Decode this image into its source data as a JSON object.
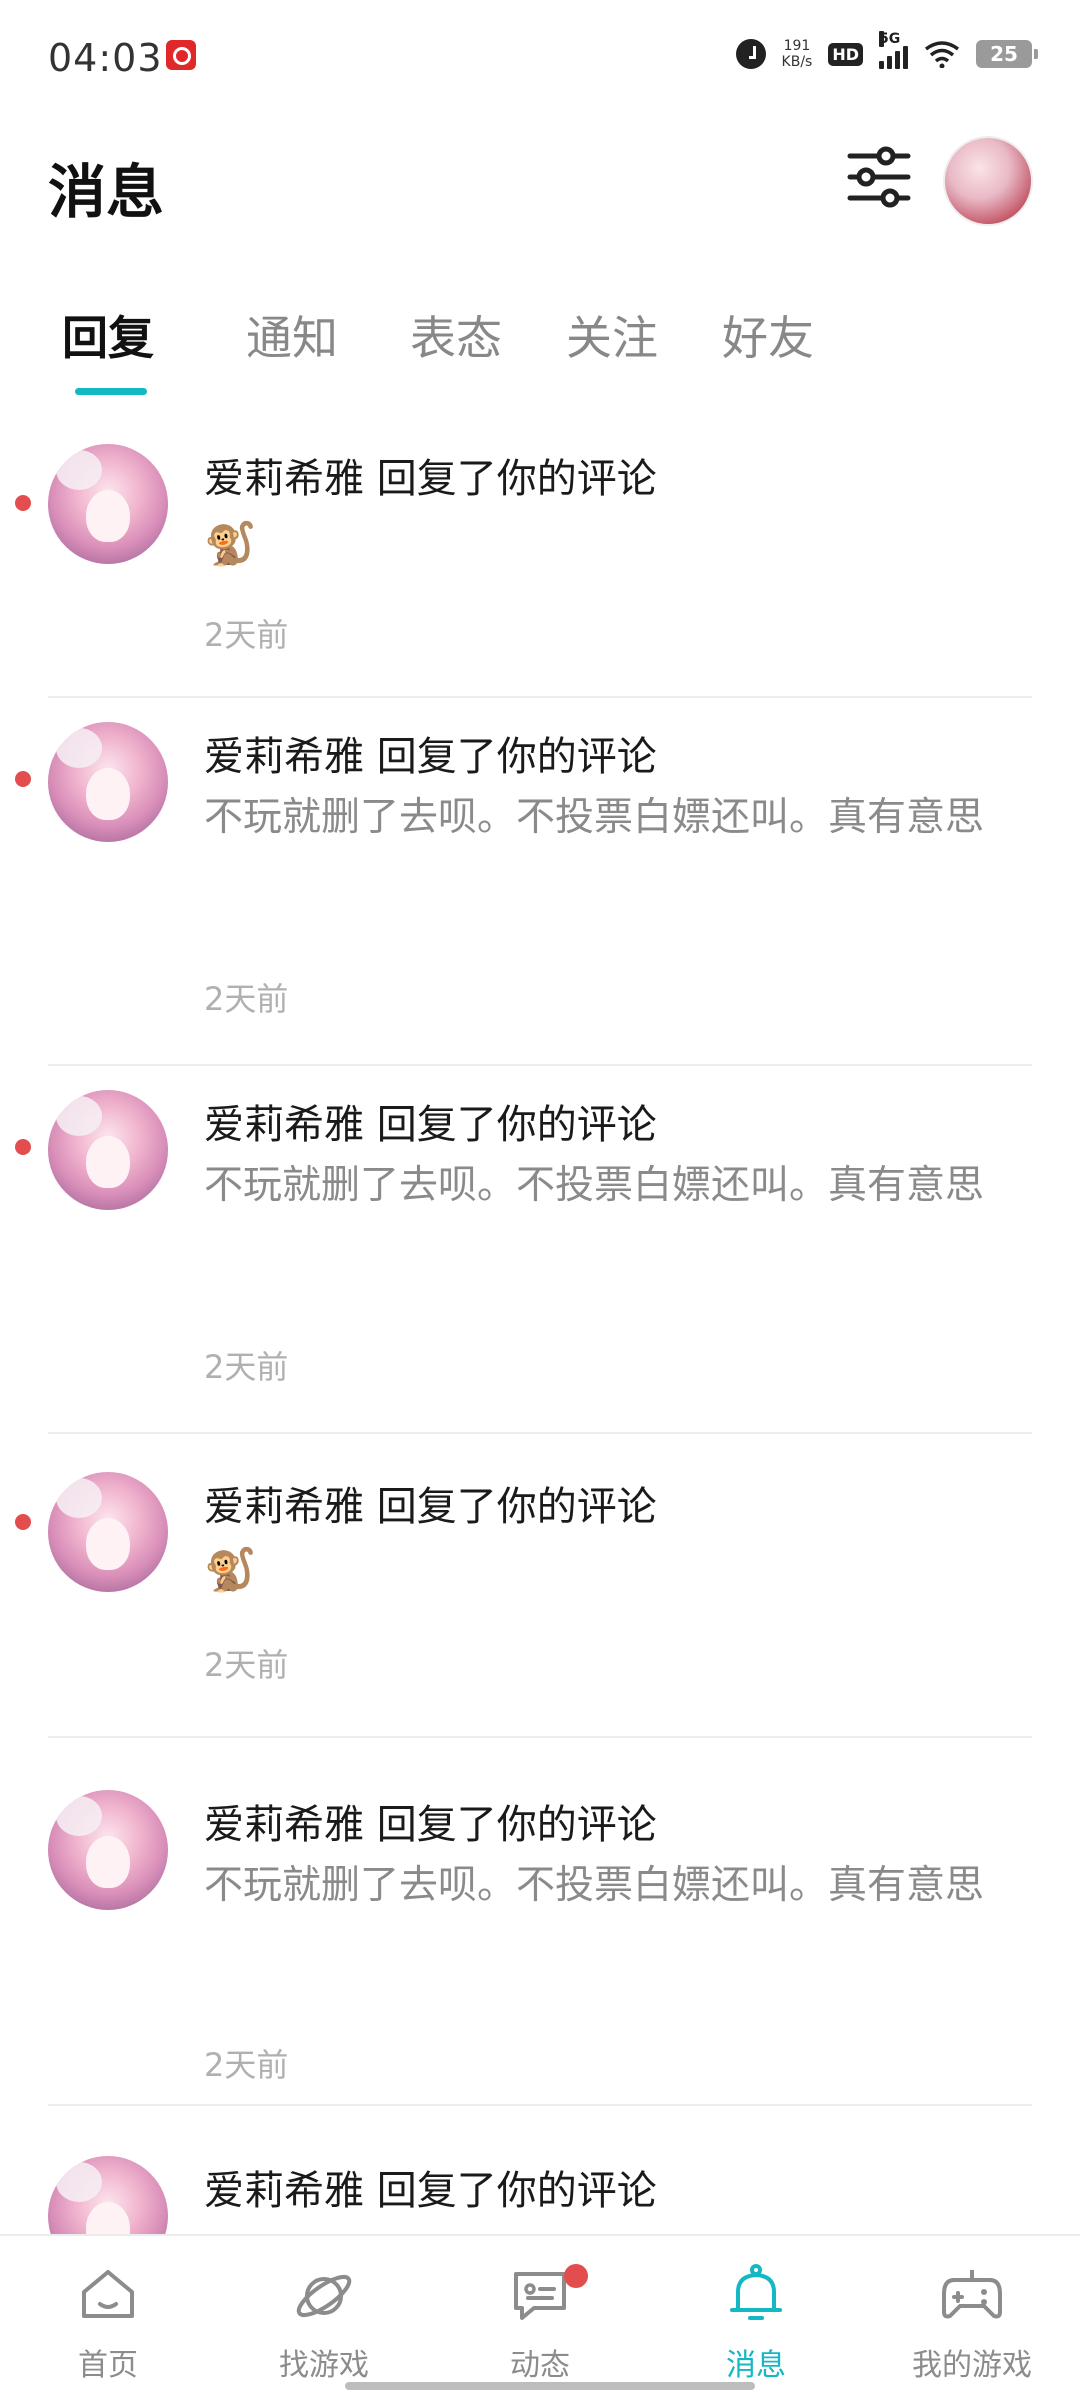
{
  "status_bar": {
    "time": "04:03",
    "net_speed_value": "191",
    "net_speed_unit": "KB/s",
    "hd_label": "HD",
    "network_label": "5G",
    "battery": "25"
  },
  "header": {
    "title": "消息"
  },
  "tabs": [
    {
      "label": "回复",
      "active": true
    },
    {
      "label": "通知"
    },
    {
      "label": "表态"
    },
    {
      "label": "关注"
    },
    {
      "label": "好友"
    }
  ],
  "messages": [
    {
      "title": "爱莉希雅 回复了你的评论",
      "body": "🐒",
      "time": "2天前",
      "unread": true
    },
    {
      "title": "爱莉希雅 回复了你的评论",
      "body": "不玩就删了去呗。不投票白嫖还叫。真有意思",
      "time": "2天前",
      "unread": true
    },
    {
      "title": "爱莉希雅 回复了你的评论",
      "body": "不玩就删了去呗。不投票白嫖还叫。真有意思",
      "time": "2天前",
      "unread": true
    },
    {
      "title": "爱莉希雅 回复了你的评论",
      "body": "🐒",
      "time": "2天前",
      "unread": true
    },
    {
      "title": "爱莉希雅 回复了你的评论",
      "body": "不玩就删了去呗。不投票白嫖还叫。真有意思",
      "time": "2天前",
      "unread": false
    },
    {
      "title": "爱莉希雅 回复了你的评论",
      "body": "",
      "time": "",
      "unread": false
    }
  ],
  "bottom_nav": [
    {
      "label": "首页",
      "icon": "home-icon"
    },
    {
      "label": "找游戏",
      "icon": "planet-icon"
    },
    {
      "label": "动态",
      "icon": "chat-icon",
      "badge": true
    },
    {
      "label": "消息",
      "icon": "bell-icon",
      "active": true
    },
    {
      "label": "我的游戏",
      "icon": "gamepad-icon"
    }
  ],
  "colors": {
    "accent": "#14b8c4",
    "unread": "#e34d4d"
  }
}
